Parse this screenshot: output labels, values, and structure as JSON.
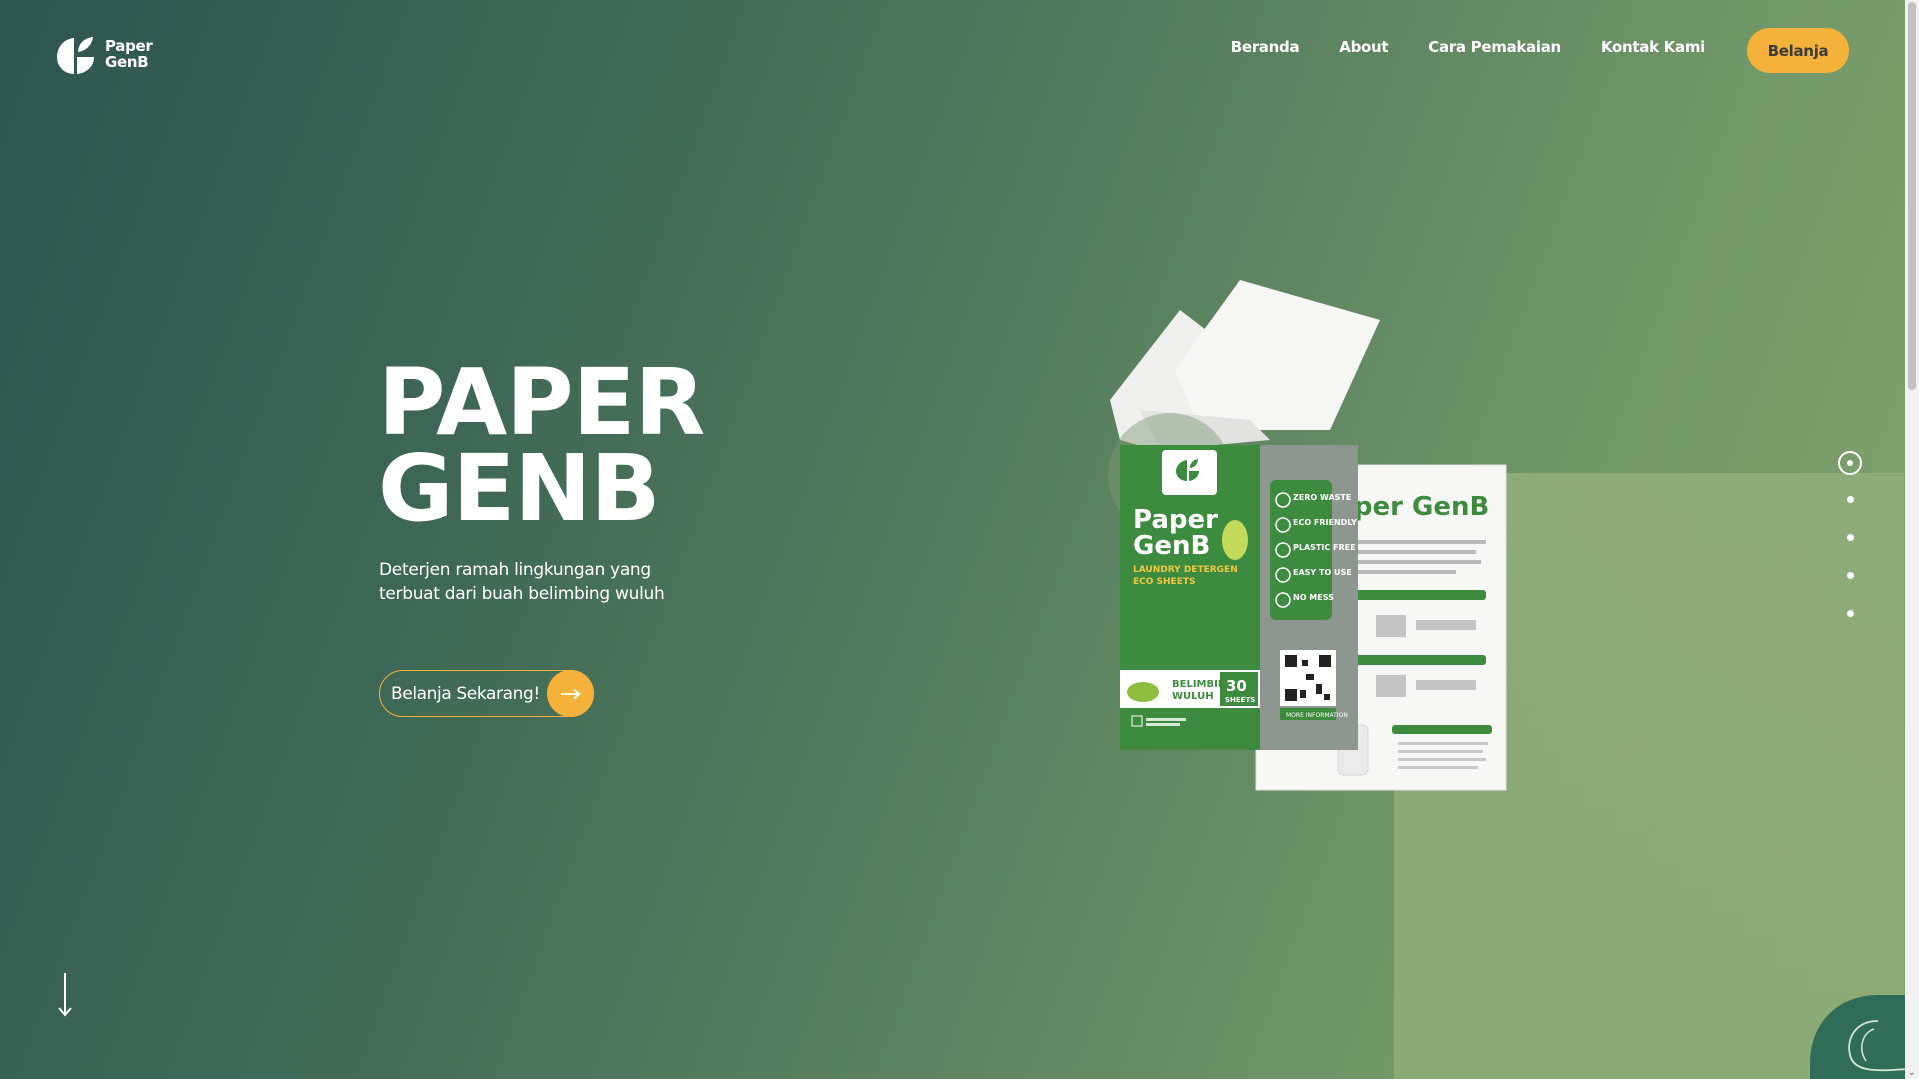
{
  "brand": {
    "name_line1": "Paper",
    "name_line2": "GenB"
  },
  "nav": {
    "items": [
      {
        "label": "Beranda"
      },
      {
        "label": "About"
      },
      {
        "label": "Cara Pemakaian"
      },
      {
        "label": "Kontak Kami"
      }
    ],
    "shop_label": "Belanja"
  },
  "hero": {
    "title_line1": "PAPER",
    "title_line2": "GENB",
    "subtitle": "Deterjen ramah lingkungan yang terbuat dari buah belimbing wuluh",
    "cta_label": "Belanja Sekarang!",
    "cta_icon": "arrow-right-icon"
  },
  "product": {
    "pack_brand": "Paper GenB",
    "pack_line1": "Paper",
    "pack_line2": "GenB",
    "pack_subtitle1": "LAUNDRY DETERGEN",
    "pack_subtitle2": "ECO SHEETS",
    "pack_fruit1": "BELIMBING",
    "pack_fruit2": "WULUH",
    "sheets_count": "30",
    "sheets_label": "SHEETS",
    "features": [
      "ZERO WASTE",
      "ECO FRIENDLY",
      "PLASTIC FREE",
      "EASY TO USE",
      "NO MESS"
    ],
    "more_info": "MORE INFORMATION"
  },
  "slider": {
    "total_dots": 5,
    "active_index": 0
  },
  "colors": {
    "accent": "#f4b23a",
    "pack_green": "#3e8a3e",
    "white": "#ffffff"
  }
}
